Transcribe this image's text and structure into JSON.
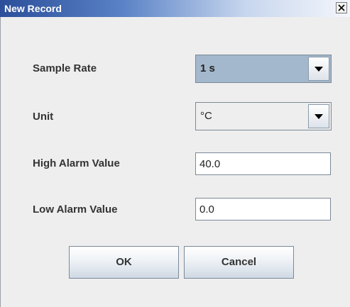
{
  "window": {
    "title": "New Record",
    "close_label": "X"
  },
  "form": {
    "sample_rate": {
      "label": "Sample Rate",
      "value": "1 s",
      "icon": "chevron-down-icon"
    },
    "unit": {
      "label": "Unit",
      "value": "°C",
      "icon": "chevron-down-icon"
    },
    "high_alarm": {
      "label": "High Alarm Value",
      "value": "40.0"
    },
    "low_alarm": {
      "label": "Low Alarm Value",
      "value": "0.0"
    }
  },
  "buttons": {
    "ok_label": "OK",
    "cancel_label": "Cancel"
  },
  "colors": {
    "title_bar_start": "#2b4f9a",
    "selected_combo": "#a3b8cc",
    "dialog_background": "#eeeeee"
  }
}
